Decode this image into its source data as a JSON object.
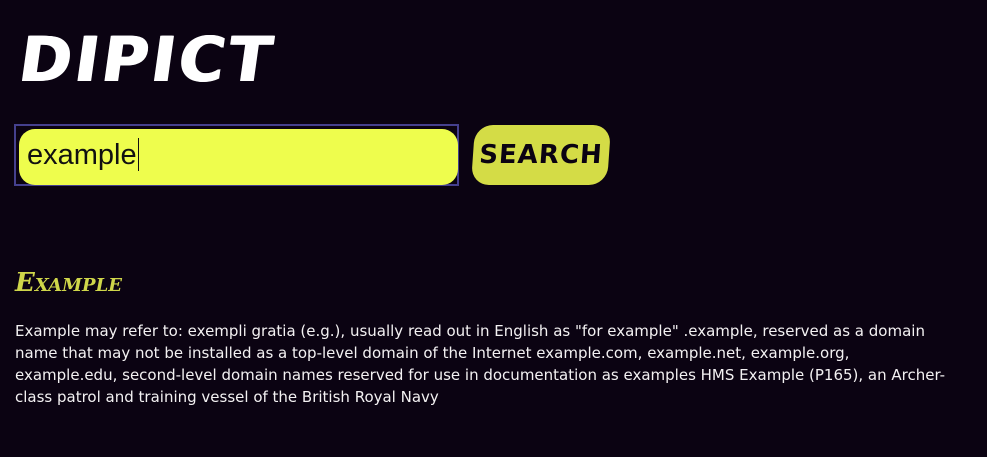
{
  "logo": {
    "text": "DIPICT"
  },
  "search": {
    "value": "example",
    "button_label": "SEARCH"
  },
  "result": {
    "title": "Example",
    "text": "Example may refer to: exempli gratia (e.g.), usually read out in English as \"for example\" .example, reserved as a domain name that may not be installed as a top-level domain of the Internet example.com, example.net, example.org, example.edu, second-level domain names reserved for use in documentation as examples HMS Example (P165), an Archer-class patrol and training vessel of the British Royal Navy"
  },
  "colors": {
    "background": "#0b0312",
    "input_fill": "#eefd4d",
    "input_border": "#45408e",
    "button_fill": "#d4dc46",
    "title_color": "#cfd64a",
    "text_color": "#f3f1f2"
  }
}
